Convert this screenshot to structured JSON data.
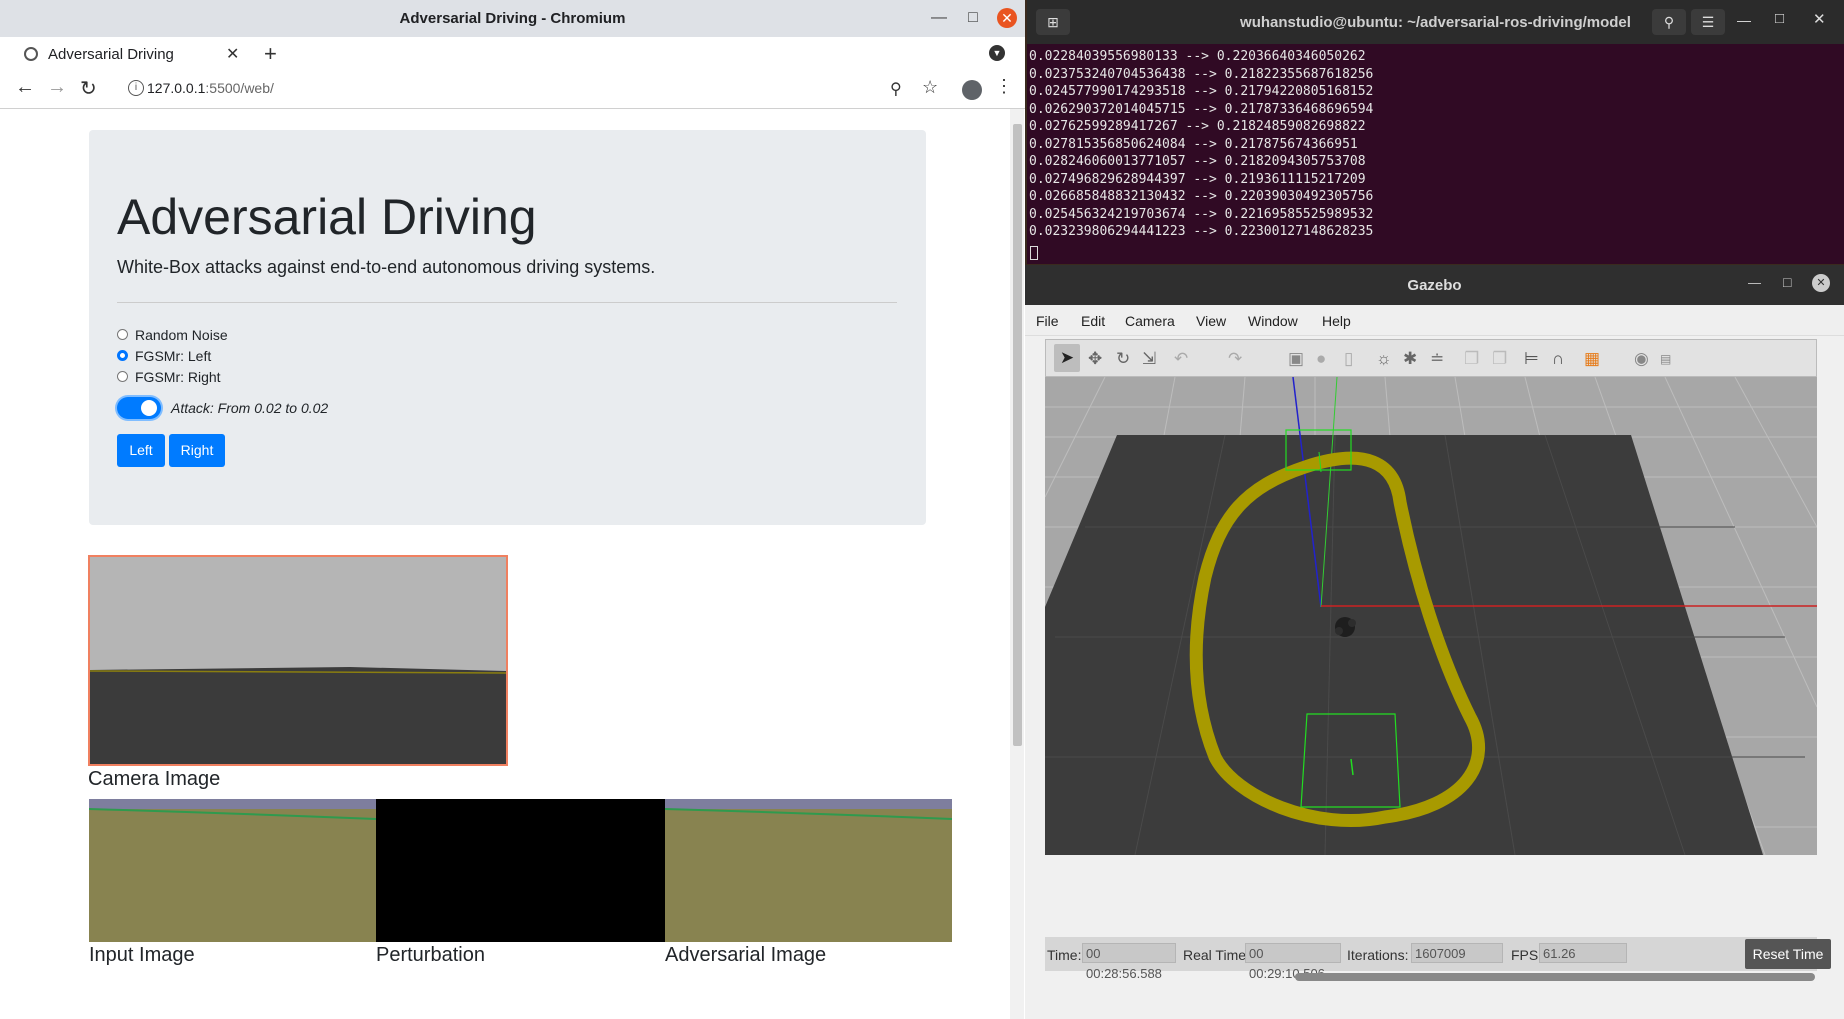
{
  "browser": {
    "window_title": "Adversarial Driving - Chromium",
    "tab_title": "Adversarial Driving",
    "url_host": "127.0.0.1",
    "url_rest": ":5500/web/"
  },
  "page": {
    "heading": "Adversarial Driving",
    "lead": "White-Box attacks against end-to-end autonomous driving systems.",
    "radios": [
      {
        "label": "Random Noise",
        "checked": false
      },
      {
        "label": "FGSMr: Left",
        "checked": true
      },
      {
        "label": "FGSMr: Right",
        "checked": false
      }
    ],
    "attack_label": "Attack: From 0.02 to 0.02",
    "attack_enabled": true,
    "left_button": "Left",
    "right_button": "Right",
    "camera_caption": "Camera Image",
    "input_caption": "Input Image",
    "perturbation_caption": "Perturbation",
    "adversarial_caption": "Adversarial Image"
  },
  "terminal": {
    "title": "wuhanstudio@ubuntu: ~/adversarial-ros-driving/model",
    "lines": [
      "0.02284039556980133 --> 0.22036640346050262",
      "0.023753240704536438 --> 0.21822355687618256",
      "0.024577990174293518 --> 0.21794220805168152",
      "0.026290372014045715 --> 0.21787336468696594",
      "0.02762599289417267 --> 0.21824859082698822",
      "0.027815356850624084 --> 0.217875674366951",
      "0.028246060013771057 --> 0.2182094305753708",
      "0.027496829628944397 --> 0.2193611115217209",
      "0.026685848832130432 --> 0.22039030492305756",
      "0.025456324219703674 --> 0.22169585525989532",
      "0.023239806294441223 --> 0.22300127148628235"
    ]
  },
  "gazebo": {
    "title": "Gazebo",
    "menus": [
      "File",
      "Edit",
      "Camera",
      "View",
      "Window",
      "Help"
    ],
    "time_label": "Time:",
    "time_value": "00 00:28:56.588",
    "real_time_label": "Real Time:",
    "real_time_value": "00 00:29:10.506",
    "iterations_label": "Iterations:",
    "iterations_value": "1607009",
    "fps_label": "FPS:",
    "fps_value": "61.26",
    "reset_button": "Reset Time"
  },
  "colors": {
    "bootstrap_blue": "#007bff",
    "terminal_bg": "#300a24",
    "ubuntu_orange": "#e95420",
    "track_yellow": "#a89a00",
    "camera_border": "#f08060"
  }
}
